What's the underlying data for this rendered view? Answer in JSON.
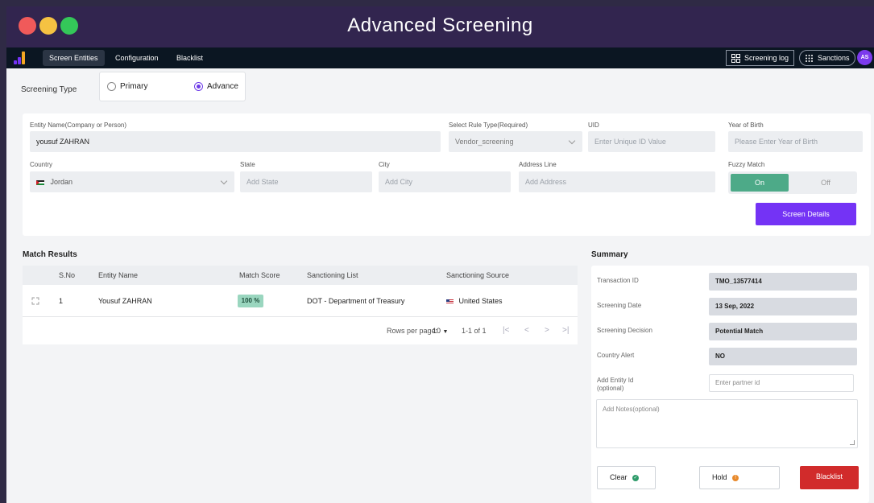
{
  "window": {
    "title": "Advanced Screening"
  },
  "nav": {
    "tabs": [
      {
        "label": "Screen Entities",
        "active": true
      },
      {
        "label": "Configuration",
        "active": false
      },
      {
        "label": "Blacklist",
        "active": false
      }
    ],
    "screening_log": "Screening log",
    "sanctions": "Sanctions",
    "avatar": "AS"
  },
  "screening_type": {
    "label": "Screening Type",
    "options": [
      {
        "label": "Primary",
        "selected": false
      },
      {
        "label": "Advance",
        "selected": true
      }
    ]
  },
  "form": {
    "entity_name": {
      "label": "Entity Name(Company or Person)",
      "value": "yousuf ZAHRAN"
    },
    "rule_type": {
      "label": "Select Rule Type(Required)",
      "value": "Vendor_screening"
    },
    "uid": {
      "label": "UID",
      "placeholder": "Enter Unique ID Value"
    },
    "year_of_birth": {
      "label": "Year of Birth",
      "placeholder": "Please Enter Year of Birth"
    },
    "country": {
      "label": "Country",
      "value": "Jordan"
    },
    "state": {
      "label": "State",
      "placeholder": "Add State"
    },
    "city": {
      "label": "City",
      "placeholder": "Add City"
    },
    "address": {
      "label": "Address Line",
      "placeholder": "Add Address"
    },
    "fuzzy": {
      "label": "Fuzzy Match",
      "on": "On",
      "off": "Off",
      "selected": "On"
    },
    "submit": "Screen Details"
  },
  "match_results": {
    "title": "Match Results",
    "columns": [
      "S.No",
      "Entity Name",
      "Match Score",
      "Sanctioning List",
      "Sanctioning Source"
    ],
    "rows": [
      {
        "sno": "1",
        "entity": "Yousuf ZAHRAN",
        "score": "100 %",
        "list": "DOT - Department of Treasury",
        "source": "United States"
      }
    ],
    "pagination": {
      "rows_per_page_label": "Rows per page:",
      "rows_per_page": "10",
      "range": "1-1 of 1"
    }
  },
  "summary": {
    "title": "Summary",
    "transaction_id": {
      "label": "Transaction ID",
      "value": "TMO_13577414"
    },
    "screening_date": {
      "label": "Screening Date",
      "value": "13 Sep, 2022"
    },
    "screening_decision": {
      "label": "Screening Decision",
      "value": "Potential Match"
    },
    "country_alert": {
      "label": "Country Alert",
      "value": "NO"
    },
    "entity_id": {
      "label": "Add Entity Id",
      "sublabel": "(optional)",
      "placeholder": "Enter partner id"
    },
    "notes": {
      "placeholder": "Add Notes(optional)"
    },
    "actions": {
      "clear": "Clear",
      "hold": "Hold",
      "blacklist": "Blacklist"
    }
  },
  "colors": {
    "titlebar": "#32254f",
    "navbar": "#0b1622",
    "accent": "#7433f5",
    "toggle_on": "#4daa88",
    "score_badge": "#9ad6bf",
    "danger": "#d12b2b"
  }
}
